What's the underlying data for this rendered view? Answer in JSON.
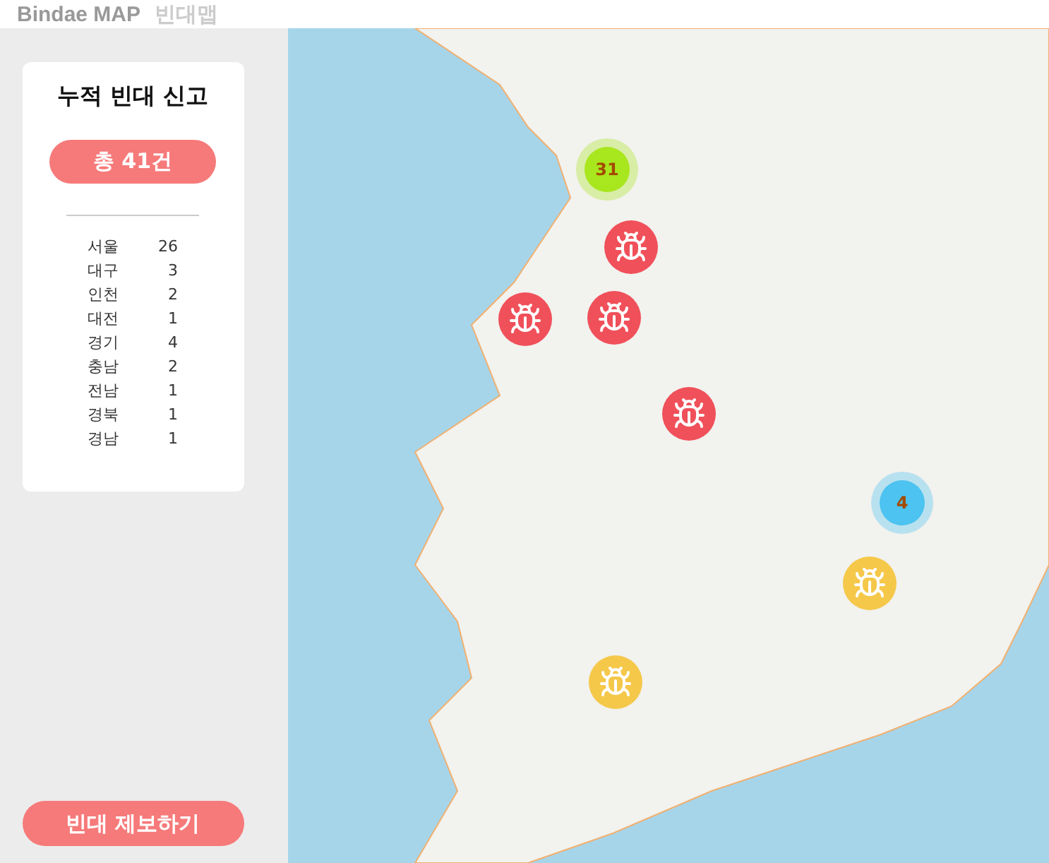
{
  "header": {
    "title": "Bindae MAP",
    "subtitle": "빈대맵"
  },
  "summary": {
    "title": "누적 빈대 신고",
    "total": "총 41건",
    "regions": [
      {
        "name": "서울",
        "count": "26"
      },
      {
        "name": "대구",
        "count": "3"
      },
      {
        "name": "인천",
        "count": "2"
      },
      {
        "name": "대전",
        "count": "1"
      },
      {
        "name": "경기",
        "count": "4"
      },
      {
        "name": "충남",
        "count": "2"
      },
      {
        "name": "전남",
        "count": "1"
      },
      {
        "name": "경북",
        "count": "1"
      },
      {
        "name": "경남",
        "count": "1"
      }
    ]
  },
  "report_button": "빈대 제보하기",
  "markers": [
    {
      "kind": "cluster",
      "count": "31",
      "color": "#a8e61e"
    },
    {
      "kind": "bug",
      "color": "#f0505a"
    },
    {
      "kind": "bug",
      "color": "#f0505a"
    },
    {
      "kind": "bug",
      "color": "#f0505a"
    },
    {
      "kind": "bug",
      "color": "#f0505a"
    },
    {
      "kind": "cluster",
      "count": "4",
      "color": "#4cc3f0"
    },
    {
      "kind": "bug",
      "color": "#f5c84a"
    },
    {
      "kind": "bug",
      "color": "#f5c84a"
    }
  ]
}
